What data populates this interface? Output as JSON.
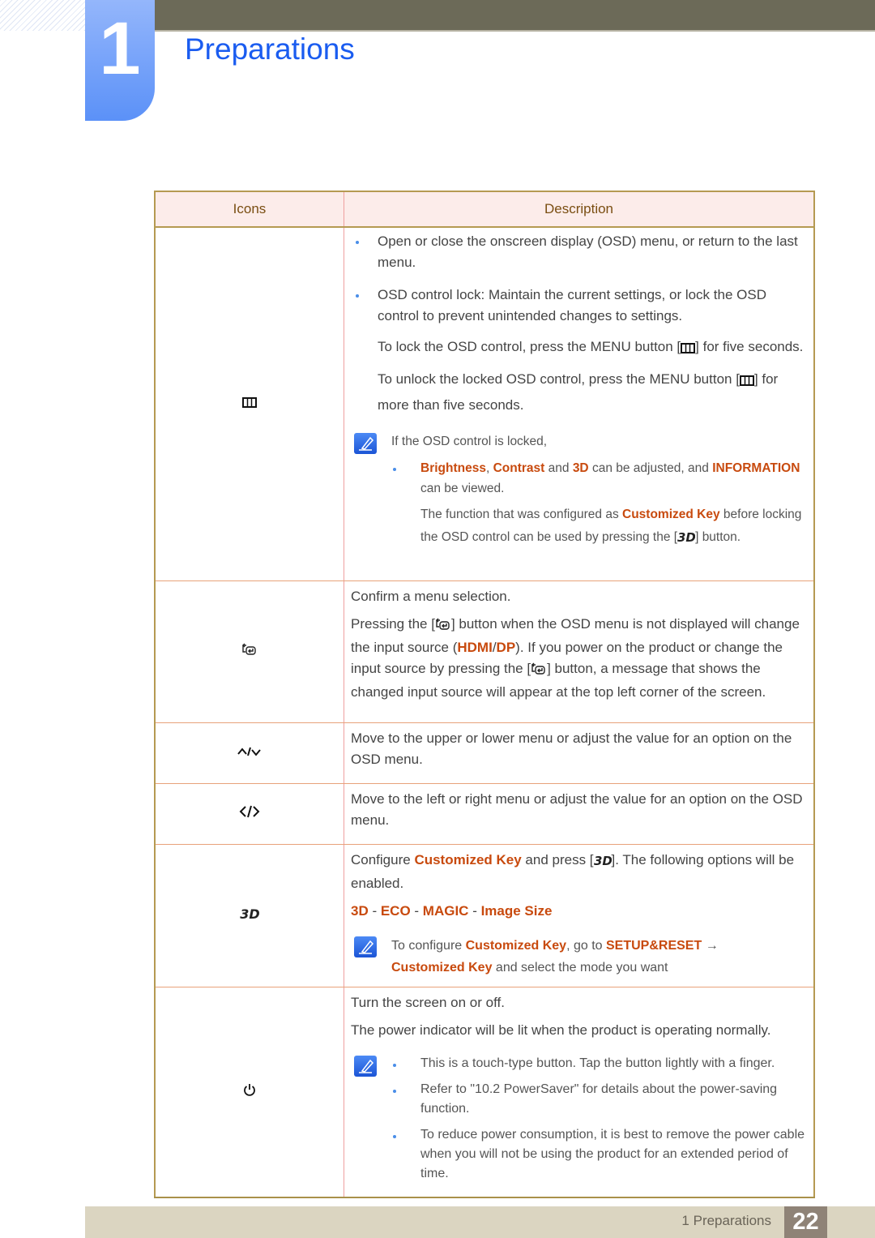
{
  "chapter": {
    "number": "1",
    "title": "Preparations"
  },
  "table": {
    "headers": {
      "icons": "Icons",
      "description": "Description"
    },
    "rows": [
      {
        "icon": "menu-icon",
        "bullets": [
          "Open or close the onscreen display (OSD) menu, or return to the last menu.",
          "OSD control lock: Maintain the current settings, or lock the OSD control to prevent unintended changes to settings."
        ],
        "lock_text": [
          "To lock the OSD control, press the MENU button [",
          "] for five seconds."
        ],
        "unlock_text": [
          "To unlock the locked OSD control, press the MENU button [",
          "] for more than five seconds."
        ],
        "note_intro": "If the OSD control is locked,",
        "note_bullet": {
          "brightness": "Brightness",
          "sep1": ", ",
          "contrast": "Contrast",
          "and1": " and ",
          "three_d": "3D",
          "mid": " can be adjusted, and ",
          "information": "INFORMATION",
          "end": " can be viewed."
        },
        "note_function": {
          "pre": "The function that was configured as ",
          "key": "Customized Key",
          "post": " before locking the OSD control can be used by pressing the [",
          "end": "] button."
        }
      },
      {
        "icon": "source-icon",
        "line1": "Confirm a menu selection.",
        "p_a": "Pressing the [",
        "p_b": "] button when the OSD menu is not displayed will change the input source (",
        "hdmi": "HDMI",
        "slash": "/",
        "dp": "DP",
        "p_c": "). If you power on the product or change the input source by pressing the [",
        "p_d": "] button, a message that shows the changed input source will appear at the top left corner of the screen."
      },
      {
        "icon": "up-down-icon",
        "text": "Move to the upper or lower menu or adjust the value for an option on the OSD menu."
      },
      {
        "icon": "left-right-icon",
        "text": "Move to the left or right menu or adjust the value for an option on the OSD menu."
      },
      {
        "icon": "3d-icon",
        "c_pre": "Configure ",
        "c_key": "Customized Key",
        "c_mid": " and press [",
        "c_end": "]. The following options will be enabled.",
        "options": [
          "3D",
          "ECO",
          "MAGIC",
          "Image Size"
        ],
        "option_sep": " - ",
        "note": {
          "pre": "To configure ",
          "key": "Customized Key",
          "mid": ", go to ",
          "setup": "SETUP&RESET",
          "arrow": " → ",
          "key2": "Customized Key",
          "end": " and select the mode you want"
        }
      },
      {
        "icon": "power-icon",
        "line1": "Turn the screen on or off.",
        "line2": "The power indicator will be lit when the product is operating normally.",
        "note_bullets": [
          "This is a touch-type button. Tap the button lightly with a finger.",
          "Refer to \"10.2 PowerSaver\" for details about the power-saving function.",
          "To reduce power consumption, it is best to remove the power cable when you will not be using the product for an extended period of time."
        ]
      }
    ]
  },
  "footer": {
    "section": "1 Preparations",
    "page": "22"
  },
  "colors": {
    "accent_blue": "#1a5cf0",
    "highlight": "#c84a0e",
    "header_bg": "#fcecea",
    "footer_bg": "#dbd5c1",
    "topbar": "#6c6a58"
  }
}
